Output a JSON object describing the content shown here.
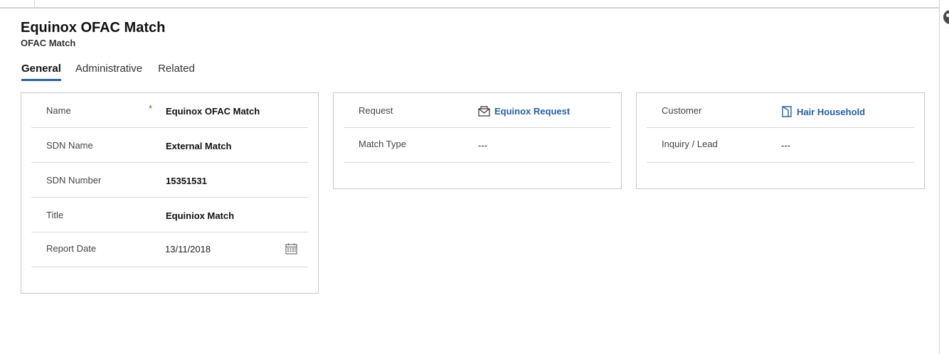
{
  "record": {
    "title": "Equinox OFAC Match",
    "entity": "OFAC Match"
  },
  "tabs": [
    {
      "label": "General",
      "active": true
    },
    {
      "label": "Administrative",
      "active": false
    },
    {
      "label": "Related",
      "active": false
    }
  ],
  "general_section": {
    "name": {
      "label": "Name",
      "required_marker": "*",
      "value": "Equinox OFAC Match"
    },
    "sdn_name": {
      "label": "SDN Name",
      "value": "External Match"
    },
    "sdn_number": {
      "label": "SDN Number",
      "value": "15351531"
    },
    "title": {
      "label": "Title",
      "value": "Equiniox Match"
    },
    "report_date": {
      "label": "Report Date",
      "value": "13/11/2018",
      "icon": "calendar-icon"
    }
  },
  "request_section": {
    "request": {
      "label": "Request",
      "value": "Equinox Request",
      "icon": "envelope-icon"
    },
    "match_type": {
      "label": "Match Type",
      "value": "---"
    }
  },
  "customer_section": {
    "customer": {
      "label": "Customer",
      "value": "Hair Household",
      "icon": "household-icon"
    },
    "inquiry_lead": {
      "label": "Inquiry / Lead",
      "value": "---"
    }
  },
  "colors": {
    "accent": "#2461b3",
    "required": "#c0392b",
    "border": "#c8c8c8"
  }
}
